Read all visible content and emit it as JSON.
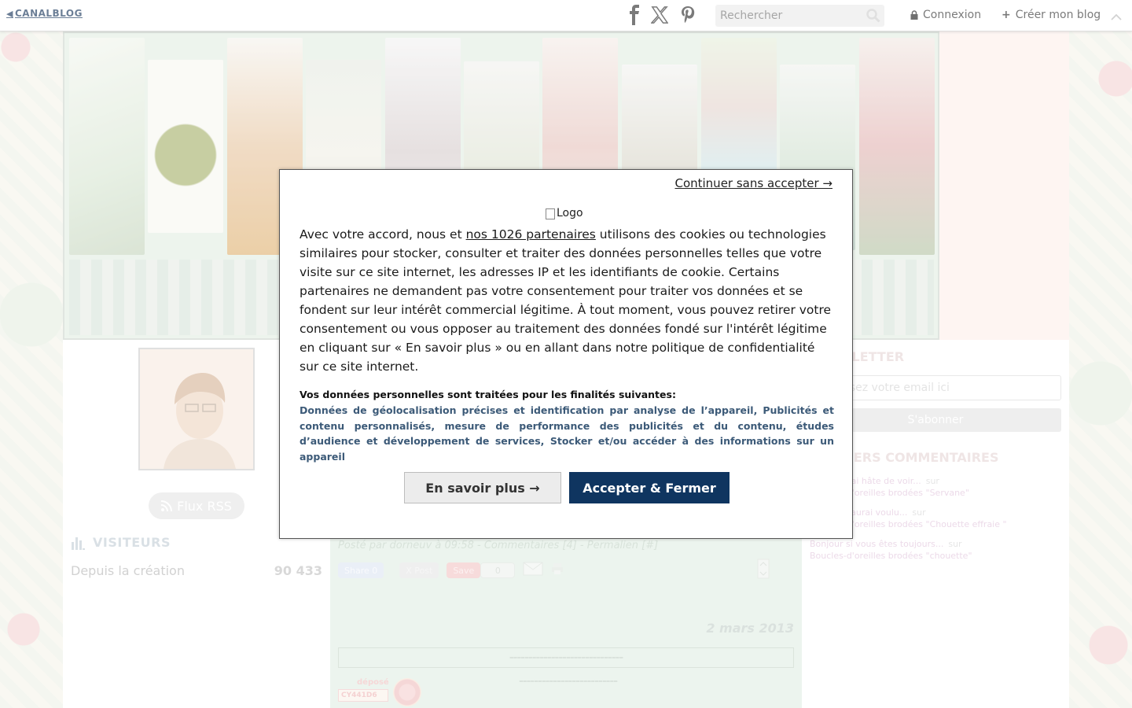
{
  "topbar": {
    "logo_text": "CANALBLOG",
    "search_placeholder": "Rechercher",
    "login_label": "Connexion",
    "create_blog_label": "Créer mon blog"
  },
  "left": {
    "rss_label": "Flux RSS",
    "visitors_title": "VISITEURS",
    "visitors_since_label": "Depuis la création",
    "visitors_count": "90 433"
  },
  "center": {
    "post_meta": "Posté par dorneuv à 09:58 - Commentaires [4] - Permalien [#]",
    "share": {
      "facebook": "Share 0",
      "x": "X Post",
      "save": "Save",
      "save_count": "0"
    },
    "date": "2 mars 2013",
    "dash_box": "------------------------------",
    "dash_line": "--------------------------",
    "stamp_label": "déposé",
    "stamp_code": "CY441D6"
  },
  "right": {
    "newsletter_title": "NEWSLETTER",
    "email_placeholder": "Saisissez votre email ici",
    "subscribe_label": "S'abonner",
    "comments_title": "DERNIERS COMMENTAIRES",
    "comments": [
      {
        "text": "Bonjour j ai hâte de voir...",
        "sur": "sur",
        "post": "Boucles-d'oreilles brodées \"Servane\""
      },
      {
        "text": "Bonjour j'aurai voulu...",
        "sur": "sur",
        "post": "Boucles-d'oreilles brodées \"Chouette effraie \""
      },
      {
        "text": "Bonjour si vous êtes toujours...",
        "sur": "sur",
        "post": "Boucles-d'oreilles brodées \"chouette\""
      }
    ]
  },
  "modal": {
    "skip_label": "Continuer sans accepter →",
    "logo_alt": "Logo",
    "text_before_link": "Avec votre accord, nous et ",
    "partners_link": "nos 1026 partenaires",
    "text_after_link": " utilisons des cookies ou technologies similaires pour stocker, consulter et traiter des données personnelles telles que votre visite sur ce site internet, les adresses IP et les identifiants de cookie. Certains partenaires ne demandent pas votre consentement pour traiter vos données et se fondent sur leur intérêt commercial légitime. À tout moment, vous pouvez retirer votre consentement ou vous opposer au traitement des données fondé sur l'intérêt légitime en cliquant sur « En savoir plus » ou en allant dans notre politique de confidentialité sur ce site internet.",
    "purposes_title": "Vos données personnelles sont traitées pour les finalités suivantes:",
    "purposes_text": "Données de géolocalisation précises et identification par analyse de l’appareil, Publicités et contenu personnalisés, mesure de performance des publicités et du contenu, études d’audience et développement de services, Stocker et/ou accéder à des informations sur un appareil",
    "more_button": "En savoir plus →",
    "accept_button": "Accepter & Fermer"
  },
  "colors": {
    "accept_bg": "#0f3560",
    "purposes_text": "#3c5a78",
    "banner_bg": "#e3efe4",
    "center_bg": "#e2efe5"
  }
}
